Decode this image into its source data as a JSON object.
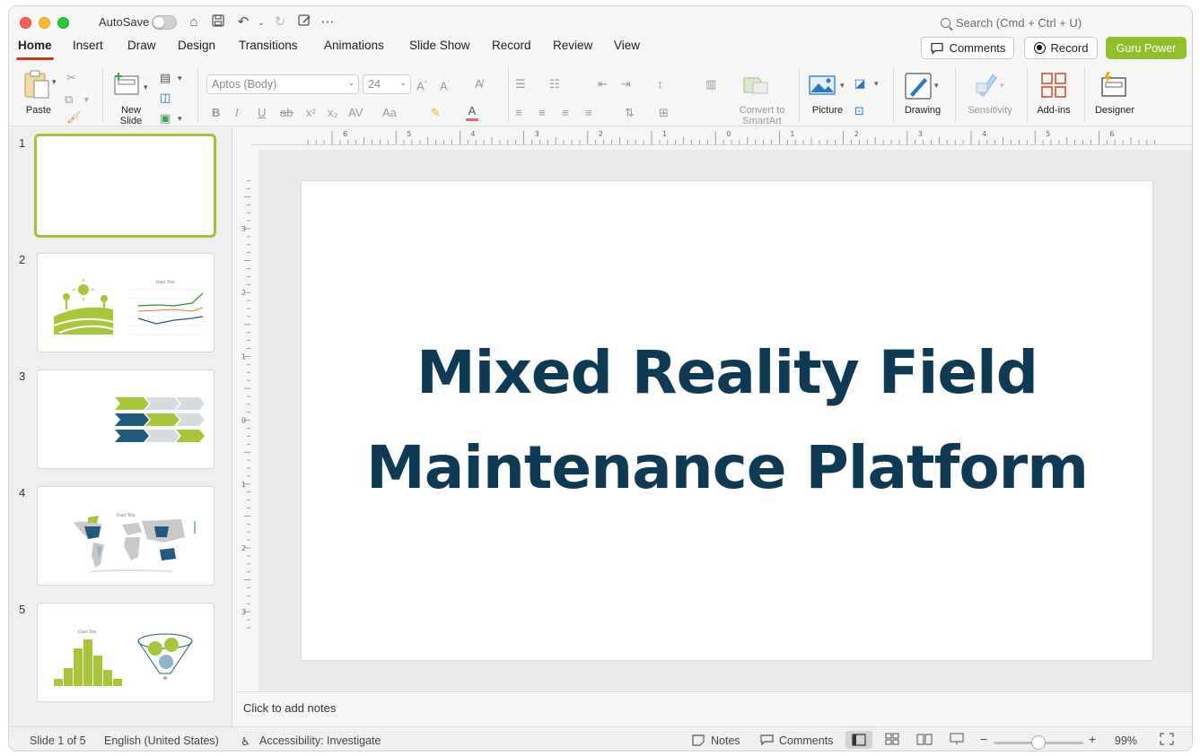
{
  "titlebar": {
    "autosave_label": "AutoSave",
    "search_placeholder": "Search (Cmd + Ctrl + U)"
  },
  "tabs": [
    {
      "label": "Home",
      "active": true
    },
    {
      "label": "Insert"
    },
    {
      "label": "Draw"
    },
    {
      "label": "Design"
    },
    {
      "label": "Transitions"
    },
    {
      "label": "Animations"
    },
    {
      "label": "Slide Show"
    },
    {
      "label": "Record"
    },
    {
      "label": "Review"
    },
    {
      "label": "View"
    }
  ],
  "header_buttons": {
    "comments": "Comments",
    "record": "Record",
    "guru": "Guru Power"
  },
  "ribbon": {
    "paste": "Paste",
    "new_slide_1": "New",
    "new_slide_2": "Slide",
    "font_name": "Aptos (Body)",
    "font_size": "24",
    "convert_1": "Convert to",
    "convert_2": "SmartArt",
    "picture": "Picture",
    "drawing": "Drawing",
    "sensitivity": "Sensitivity",
    "addins": "Add-ins",
    "designer": "Designer"
  },
  "ruler_h_ticks": [
    "6",
    "5",
    "4",
    "3",
    "2",
    "1",
    "0",
    "1",
    "2",
    "3",
    "4",
    "5",
    "6"
  ],
  "ruler_v_ticks": [
    "3",
    "2",
    "1",
    "0",
    "1",
    "2",
    "3"
  ],
  "slides": [
    {
      "num": "1"
    },
    {
      "num": "2",
      "chart_title": "Chart Title"
    },
    {
      "num": "3"
    },
    {
      "num": "4",
      "chart_title": "Chart Title"
    },
    {
      "num": "5",
      "chart_title": "Chart Title"
    }
  ],
  "current_slide": {
    "title_line1": "Mixed Reality Field",
    "title_line2": "Maintenance Platform"
  },
  "notes_placeholder": "Click to add notes",
  "status": {
    "slide_count": "Slide 1 of 5",
    "language": "English (United States)",
    "accessibility": "Accessibility: Investigate",
    "notes": "Notes",
    "comments": "Comments",
    "zoom": "99%"
  },
  "colors": {
    "accent_red": "#c43e1c",
    "guru_green": "#8fbf2b",
    "title_navy": "#0f3a55",
    "lime": "#a7c63a",
    "teal": "#1f5b7e"
  }
}
